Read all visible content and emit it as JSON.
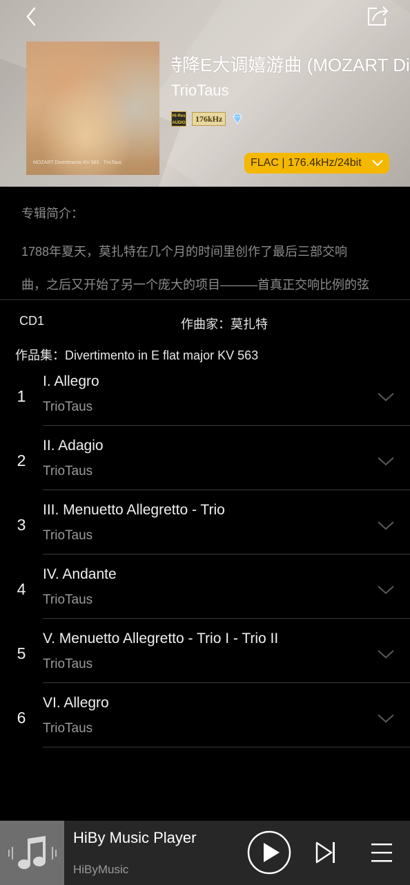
{
  "header": {
    "album_title": "特降E大调嬉游曲 (MOZART Di",
    "artist": "TrioTaus",
    "badges": {
      "hires_top": "Hi-Res",
      "hires_bottom": "AUDIO",
      "khz": "176kHz"
    },
    "format": "FLAC | 176.4kHz/24bit",
    "cover_caption": "MOZART Divertimento KV 563 · TrioTaus"
  },
  "intro": {
    "label": "专辑简介：",
    "lines": [
      "1788年夏天，莫扎特在几个月的时间里创作了最后三部交响",
      "曲，之后又开始了另一个庞大的项目———首真正交响比例的弦"
    ]
  },
  "disc": {
    "cd_label": "CD1",
    "composer": "作曲家：莫扎特",
    "work": "作品集：Divertimento in E flat major KV 563"
  },
  "tracks": [
    {
      "num": "1",
      "title": "I.  Allegro",
      "artist": "TrioTaus"
    },
    {
      "num": "2",
      "title": "II.  Adagio",
      "artist": "TrioTaus"
    },
    {
      "num": "3",
      "title": "III.  Menuetto Allegretto - Trio",
      "artist": "TrioTaus"
    },
    {
      "num": "4",
      "title": "IV.  Andante",
      "artist": "TrioTaus"
    },
    {
      "num": "5",
      "title": "V.  Menuetto Allegretto - Trio I - Trio II",
      "artist": "TrioTaus"
    },
    {
      "num": "6",
      "title": "VI.  Allegro",
      "artist": "TrioTaus"
    }
  ],
  "player": {
    "song": "HiBy Music Player",
    "artist": "HiByMusic"
  },
  "colors": {
    "accent": "#f5b800",
    "background": "#000000",
    "muted_text": "#8c8c8c",
    "player_bar": "#272727"
  },
  "icons": [
    "back-arrow-icon",
    "share-icon",
    "hires-audio-icon",
    "diamond-icon",
    "chevron-down-icon",
    "music-note-icon",
    "play-icon",
    "skip-next-icon",
    "queue-list-icon"
  ]
}
